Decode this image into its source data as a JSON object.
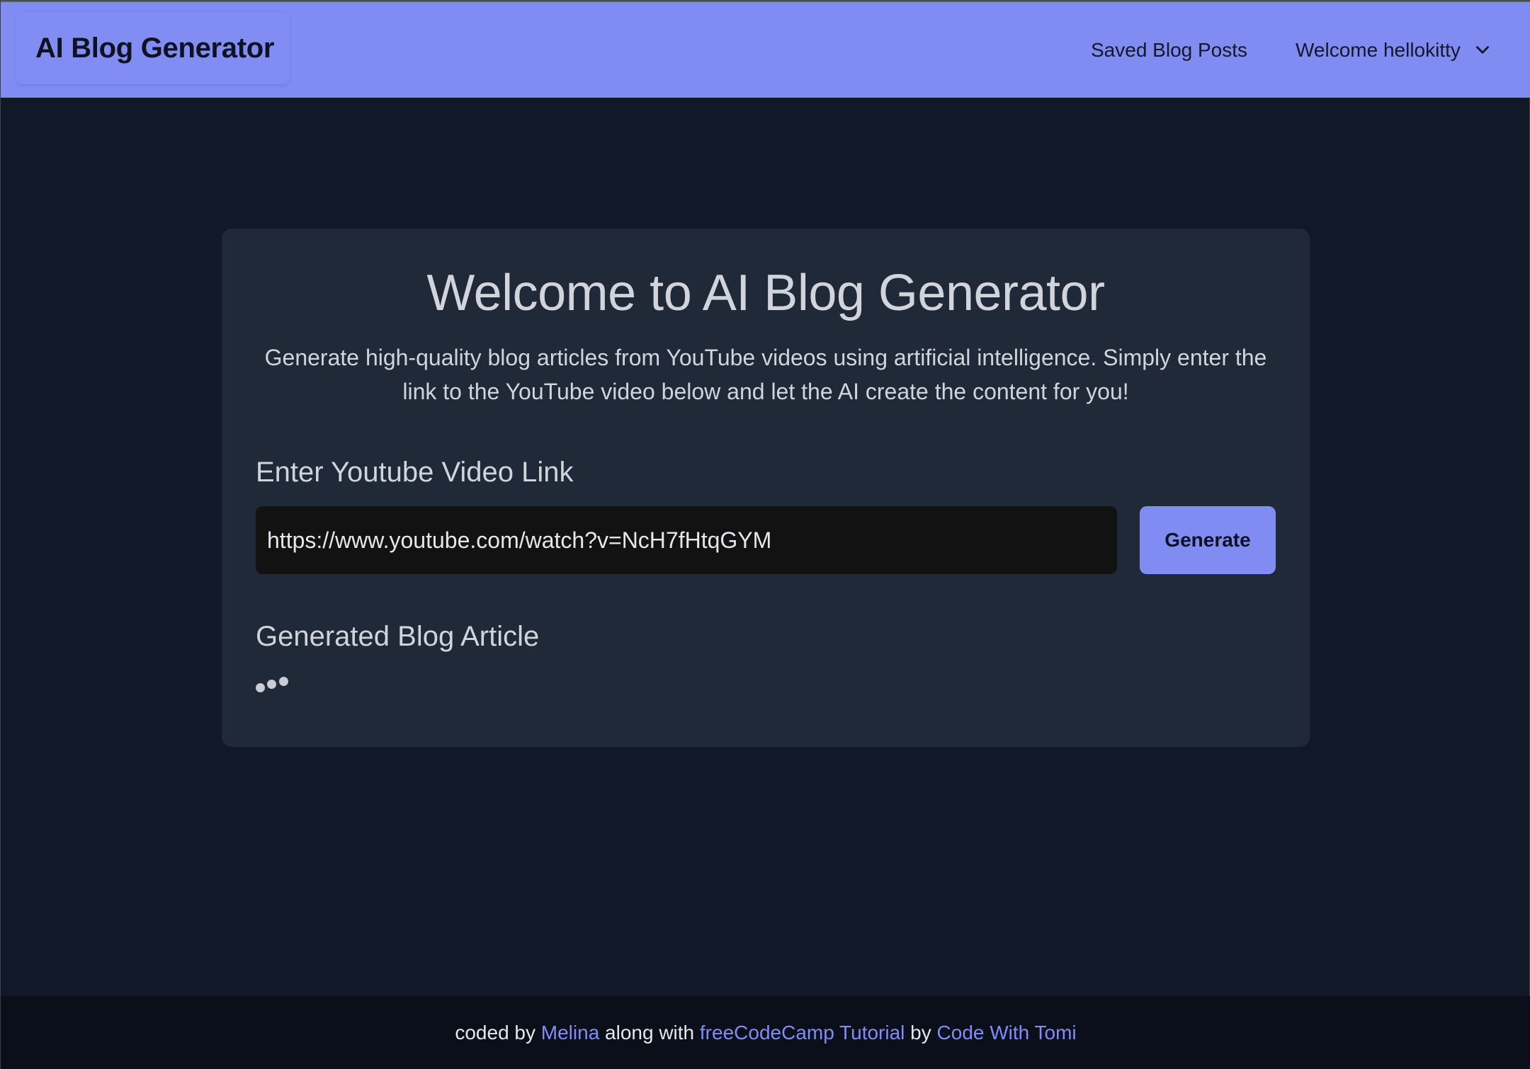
{
  "header": {
    "brand": "AI Blog Generator",
    "nav": {
      "saved_posts": "Saved Blog Posts",
      "user_menu": "Welcome hellokitty"
    }
  },
  "main": {
    "title": "Welcome to AI Blog Generator",
    "description": "Generate high-quality blog articles from YouTube videos using artificial intelligence. Simply enter the link to the YouTube video below and let the AI create the content for you!",
    "link_label": "Enter Youtube Video Link",
    "link_input": {
      "value": "https://www.youtube.com/watch?v=NcH7fHtqGYM"
    },
    "generate_button": "Generate",
    "article_label": "Generated Blog Article"
  },
  "footer": {
    "text1": "coded by ",
    "author": "Melina",
    "text2": " along with ",
    "tutorial": "freeCodeCamp Tutorial",
    "text3": " by ",
    "channel": "Code With Tomi"
  },
  "colors": {
    "accent": "#818cf2",
    "background": "#111827",
    "card": "#1f2937",
    "footer": "#0b0f19",
    "link": "#818cf8"
  },
  "icons": {
    "user_menu_toggle": "chevron-down-icon",
    "loading": "loading-dots-icon"
  }
}
